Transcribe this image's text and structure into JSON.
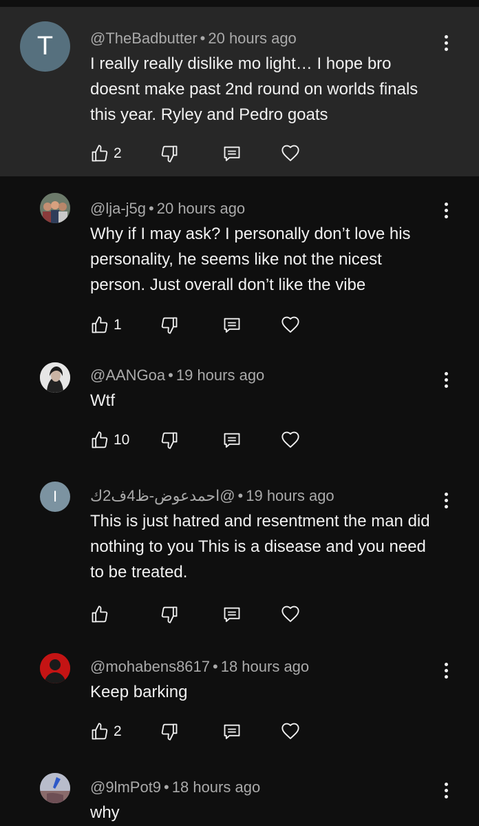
{
  "comments": [
    {
      "author": "@TheBadbutter",
      "time": "20 hours ago",
      "text": "I really really dislike mo light… I hope bro doesnt make past 2nd round on worlds finals this year. Ryley and Pedro goats",
      "likes": "2",
      "avatar_letter": "T"
    },
    {
      "author": "@lja-j5g",
      "time": "20 hours ago",
      "text": "Why if I may ask? I personally don’t love his personality, he seems like not the nicest person. Just overall don’t like the vibe",
      "likes": "1"
    },
    {
      "author": "@AANGoa",
      "time": "19 hours ago",
      "text": "Wtf",
      "likes": "10"
    },
    {
      "author": "@احمدعوض-ظ4ف2ك",
      "time": "19 hours ago",
      "text": "This is just hatred and resentment the man did nothing to you This is a disease and you need to be treated.",
      "likes": "",
      "avatar_letter": "I"
    },
    {
      "author": "@mohabens8617",
      "time": "18 hours ago",
      "text": "Keep barking",
      "likes": "2"
    },
    {
      "author": "@9lmPot9",
      "time": "18 hours ago",
      "text": "why",
      "likes": ""
    }
  ],
  "separator": "•",
  "icons": {
    "like": "thumbs-up-icon",
    "dislike": "thumbs-down-icon",
    "reply": "reply-icon",
    "heart": "heart-icon",
    "more": "more-vert-icon"
  }
}
